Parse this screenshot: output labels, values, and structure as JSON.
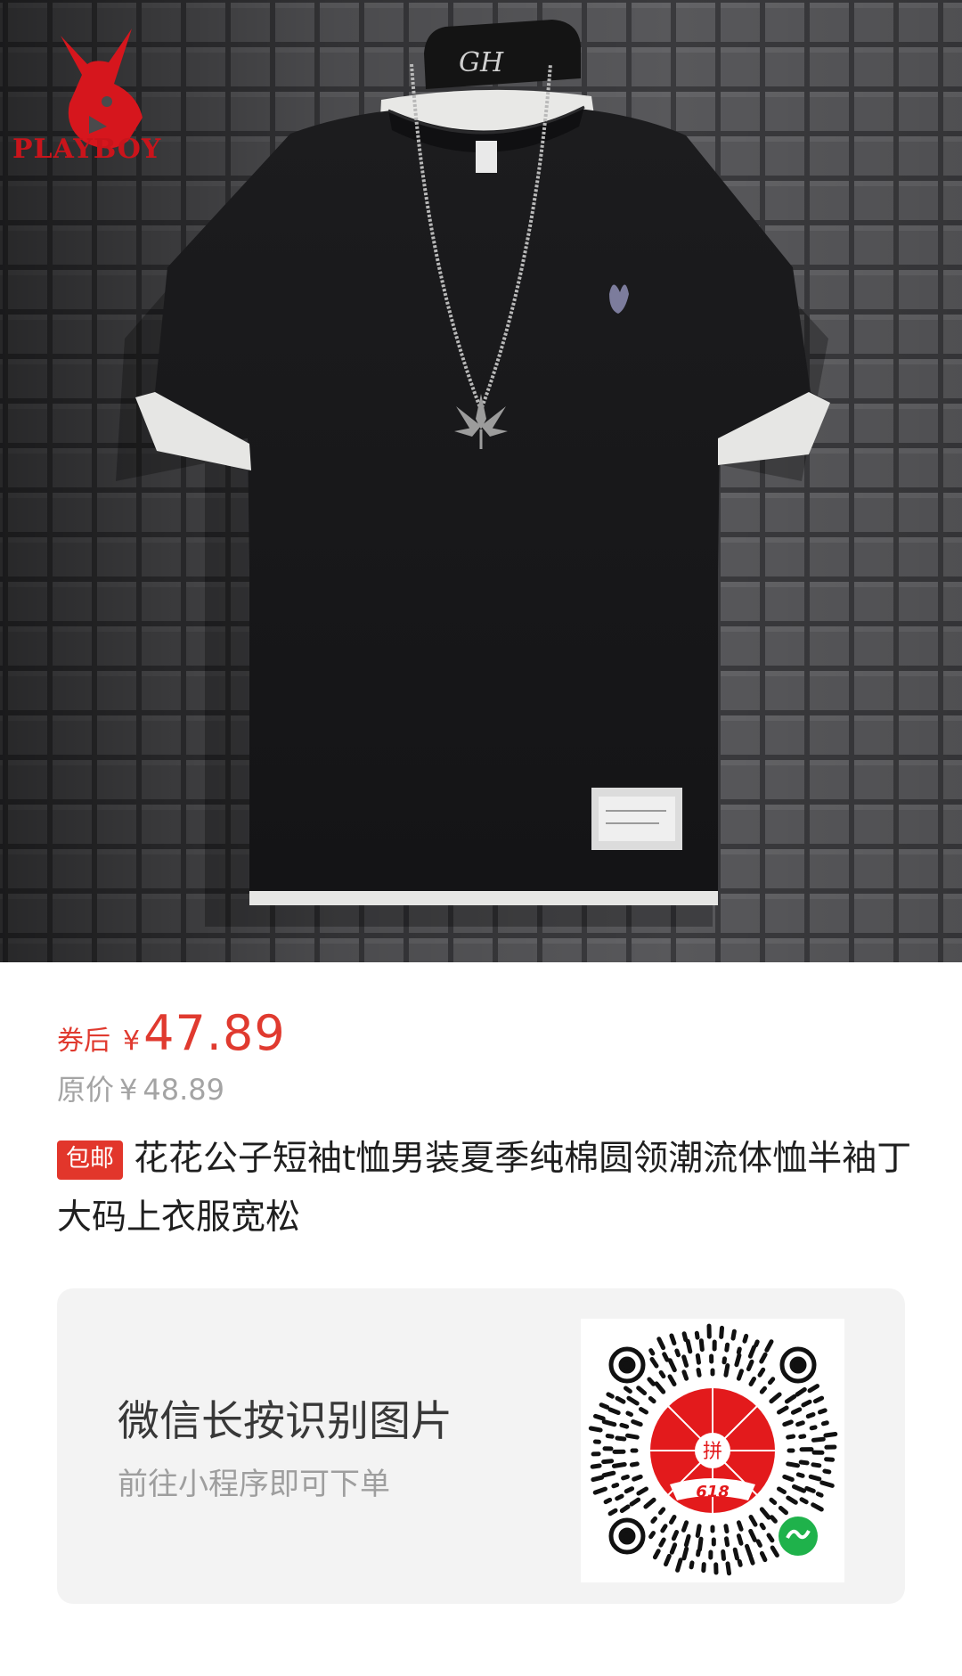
{
  "product_image": {
    "brand": "PLAYBOY",
    "hanger_text": "GH"
  },
  "price": {
    "prefix": "券后",
    "currency": "¥",
    "value": "47.89"
  },
  "original_price": {
    "label": "原价",
    "currency": "¥",
    "value": "48.89"
  },
  "product": {
    "badge": "包邮",
    "title": "花花公子短袖t恤男装夏季纯棉圆领潮流体恤半袖丁大码上衣服宽松"
  },
  "qr_card": {
    "main_text": "微信长按识别图片",
    "sub_text": "前往小程序即可下单",
    "code_label": "618",
    "code_center_text": "拼"
  },
  "colors": {
    "accent": "#e03a2f",
    "badge": "#e2362b",
    "muted": "#a4a4a4",
    "card_bg": "#f3f3f3"
  }
}
